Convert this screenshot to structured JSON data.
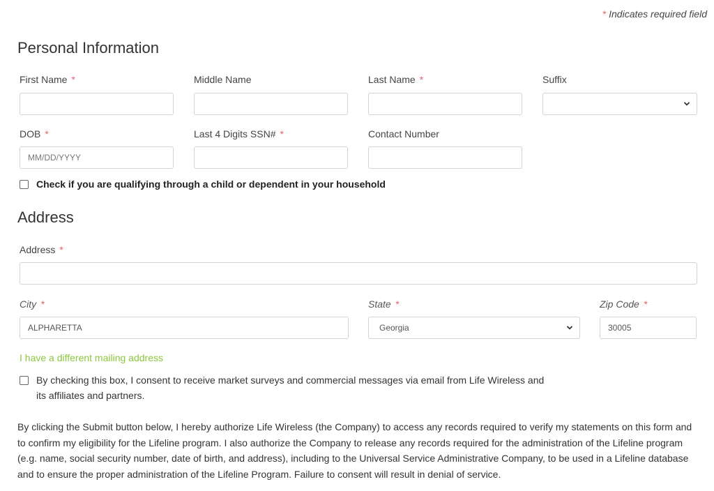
{
  "required_note": {
    "star": "*",
    "text": "Indicates required field"
  },
  "personal": {
    "title": "Personal Information",
    "first_name": {
      "label": "First Name",
      "required": "*",
      "value": ""
    },
    "middle_name": {
      "label": "Middle Name",
      "value": ""
    },
    "last_name": {
      "label": "Last Name",
      "required": "*",
      "value": ""
    },
    "suffix": {
      "label": "Suffix",
      "value": ""
    },
    "dob": {
      "label": "DOB",
      "required": "*",
      "placeholder": "MM/DD/YYYY",
      "value": ""
    },
    "ssn": {
      "label": "Last 4 Digits SSN#",
      "required": "*",
      "value": ""
    },
    "contact": {
      "label": "Contact Number",
      "value": ""
    },
    "dependent_checkbox": {
      "label": "Check if you are qualifying through a child or dependent in your household",
      "checked": false
    }
  },
  "address": {
    "title": "Address",
    "address": {
      "label": "Address",
      "required": "*",
      "value": ""
    },
    "city": {
      "label": "City",
      "required": "*",
      "value": "ALPHARETTA"
    },
    "state": {
      "label": "State",
      "required": "*",
      "value": "Georgia"
    },
    "zip": {
      "label": "Zip Code",
      "required": "*",
      "value": "30005"
    },
    "mailing_link": "I have a different mailing address",
    "consent_checkbox": {
      "line1": "By checking this box, I consent to receive market surveys and commercial messages via email from Life Wireless and",
      "line2": "its affiliates and partners.",
      "checked": false
    }
  },
  "legal_text": "By clicking the Submit button below, I hereby authorize Life Wireless (the Company) to access any records required to verify my statements on this form and to confirm my eligibility for the Lifeline program. I also authorize the Company to release any records required for the administration of the Lifeline program (e.g. name, social security number, date of birth, and address), including to the Universal Service Administrative Company, to be used in a Lifeline database and to ensure the proper administration of the Lifeline Program. Failure to consent will result in denial of service.",
  "colors": {
    "required_star": "#e4606d",
    "link_green": "#8dc63f",
    "border": "#ced4da"
  }
}
